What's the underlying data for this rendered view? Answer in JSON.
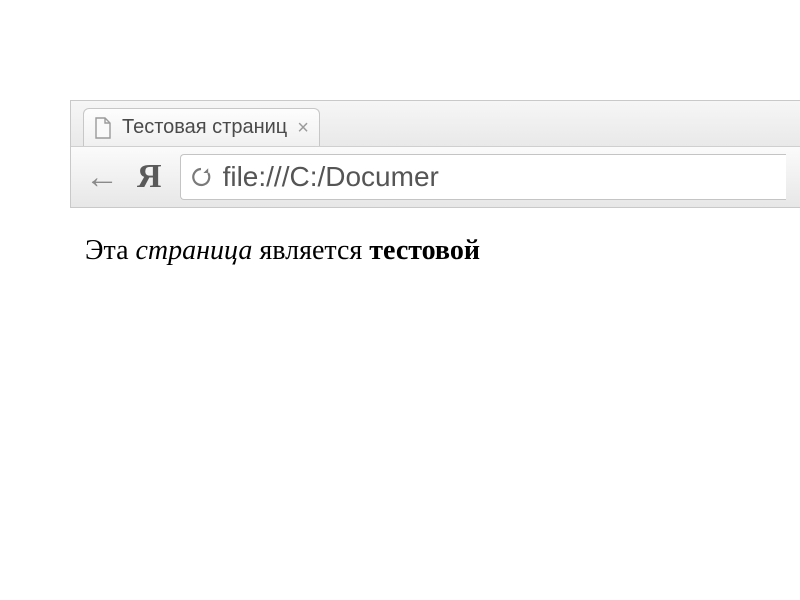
{
  "tab": {
    "title": "Тестовая страниц",
    "close_char": "×"
  },
  "toolbar": {
    "back_char": "←",
    "brand_char": "Я",
    "url": "file:///C:/Documer"
  },
  "page": {
    "text_plain_1": "Эта ",
    "text_italic": "страница",
    "text_plain_2": " является ",
    "text_bold": "тестовой"
  }
}
